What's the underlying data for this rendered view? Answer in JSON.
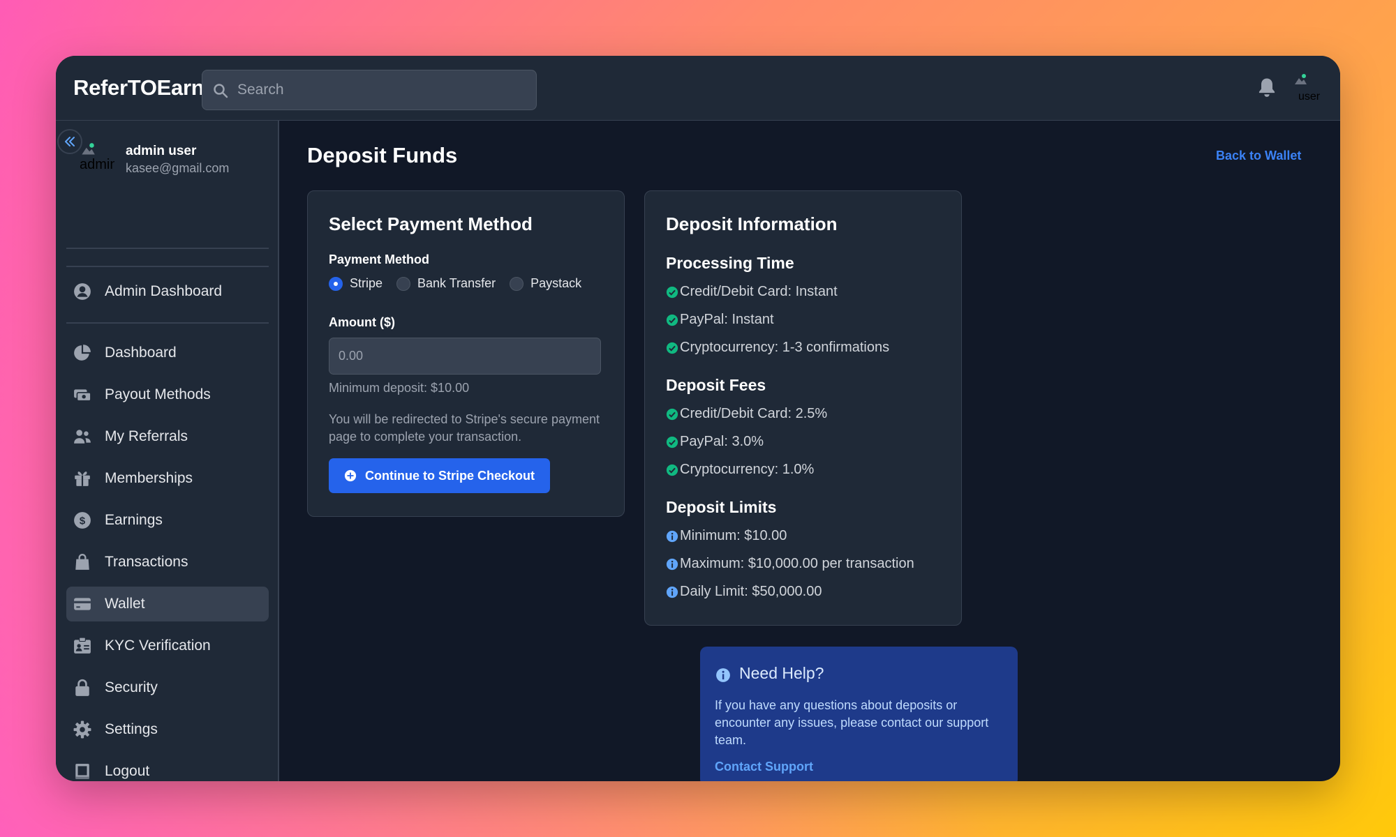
{
  "header": {
    "brand": "ReferTOEarn",
    "search_placeholder": "Search",
    "user_avatar_alt": "user"
  },
  "sidebar": {
    "profile": {
      "name": "admin user",
      "email": "kasee@gmail.com",
      "avatar_alt": "admin"
    },
    "admin_item": {
      "label": "Admin Dashboard",
      "icon": "user-circle-icon"
    },
    "items": [
      {
        "label": "Dashboard",
        "icon": "pie-chart-icon"
      },
      {
        "label": "Payout Methods",
        "icon": "money-bill-icon"
      },
      {
        "label": "My Referrals",
        "icon": "users-icon"
      },
      {
        "label": "Memberships",
        "icon": "gift-icon"
      },
      {
        "label": "Earnings",
        "icon": "dollar-circle-icon"
      },
      {
        "label": "Transactions",
        "icon": "shopping-bag-icon"
      },
      {
        "label": "Wallet",
        "icon": "credit-card-icon",
        "active": true
      },
      {
        "label": "KYC Verification",
        "icon": "id-card-icon"
      },
      {
        "label": "Security",
        "icon": "lock-icon"
      },
      {
        "label": "Settings",
        "icon": "gear-icon"
      },
      {
        "label": "Logout",
        "icon": "logout-icon"
      }
    ]
  },
  "main": {
    "title": "Deposit Funds",
    "back_link": "Back to Wallet",
    "payment_card": {
      "title": "Select Payment Method",
      "method_label": "Payment Method",
      "methods": [
        "Stripe",
        "Bank Transfer",
        "Paystack"
      ],
      "selected_method": "Stripe",
      "amount_label": "Amount ($)",
      "amount_placeholder": "0.00",
      "minimum_note": "Minimum deposit: $10.00",
      "redirect_note": "You will be redirected to Stripe's secure payment page to complete your transaction.",
      "button_label": "Continue to Stripe Checkout"
    },
    "info_card": {
      "title": "Deposit Information",
      "processing_title": "Processing Time",
      "processing": [
        "Credit/Debit Card: Instant",
        "PayPal: Instant",
        "Cryptocurrency: 1-3 confirmations"
      ],
      "fees_title": "Deposit Fees",
      "fees": [
        "Credit/Debit Card: 2.5%",
        "PayPal: 3.0%",
        "Cryptocurrency: 1.0%"
      ],
      "limits_title": "Deposit Limits",
      "limits": [
        "Minimum: $10.00",
        "Maximum: $10,000.00 per transaction",
        "Daily Limit: $50,000.00"
      ]
    },
    "help_card": {
      "title": "Need Help?",
      "text": "If you have any questions about deposits or encounter any issues, please contact our support team.",
      "link": "Contact Support"
    }
  },
  "colors": {
    "accent": "#2563eb",
    "link": "#3b82f6",
    "success": "#10b981",
    "info": "#60a5fa",
    "panel": "#1f2937",
    "background": "#111827"
  }
}
